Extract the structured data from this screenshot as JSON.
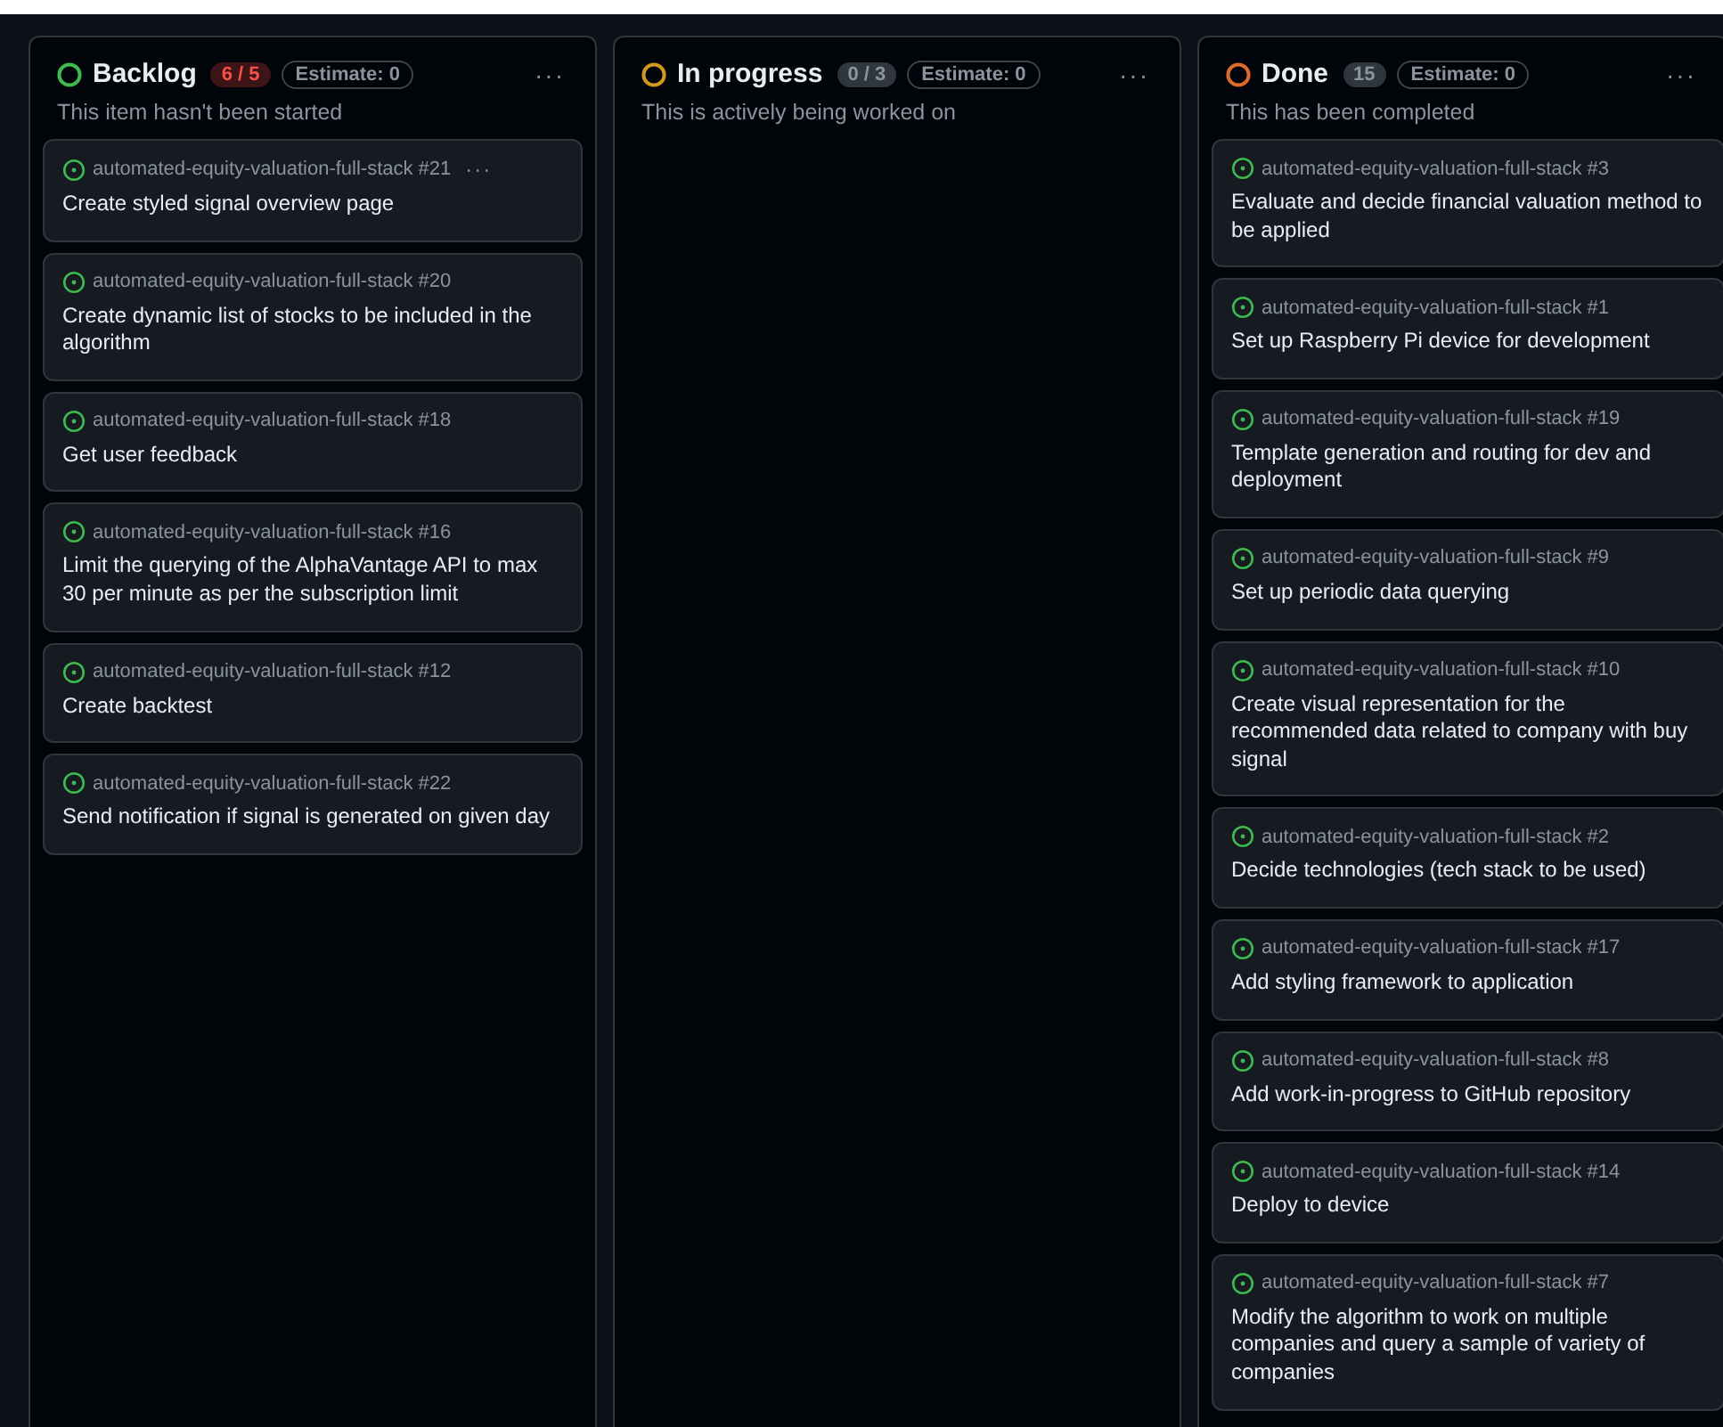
{
  "columns": [
    {
      "title": "Backlog",
      "color": "#3fb950",
      "count": "6 / 5",
      "over_limit": true,
      "estimate": "Estimate: 0",
      "menu": "···",
      "description": "This item hasn't been started",
      "cards": [
        {
          "repo": "automated-equity-valuation-full-stack #21",
          "title": "Create styled signal overview page",
          "menu": "···"
        },
        {
          "repo": "automated-equity-valuation-full-stack #20",
          "title": "Create dynamic list of stocks to be included in the algorithm"
        },
        {
          "repo": "automated-equity-valuation-full-stack #18",
          "title": "Get user feedback"
        },
        {
          "repo": "automated-equity-valuation-full-stack #16",
          "title": "Limit the querying of the AlphaVantage API to max 30 per minute as per the subscription limit"
        },
        {
          "repo": "automated-equity-valuation-full-stack #12",
          "title": "Create backtest"
        },
        {
          "repo": "automated-equity-valuation-full-stack #22",
          "title": "Send notification if signal is generated on given day"
        }
      ]
    },
    {
      "title": "In progress",
      "color": "#d29922",
      "count": "0 / 3",
      "over_limit": false,
      "estimate": "Estimate: 0",
      "menu": "···",
      "description": "This is actively being worked on"
    },
    {
      "title": "Done",
      "color": "#db6d28",
      "count": "15",
      "over_limit": false,
      "estimate": "Estimate: 0",
      "menu": "···",
      "description": "This has been completed",
      "cards": [
        {
          "repo": "automated-equity-valuation-full-stack #3",
          "title": "Evaluate and decide financial valuation method to be applied"
        },
        {
          "repo": "automated-equity-valuation-full-stack #1",
          "title": "Set up Raspberry Pi device for development"
        },
        {
          "repo": "automated-equity-valuation-full-stack #19",
          "title": "Template generation and routing for dev and deployment"
        },
        {
          "repo": "automated-equity-valuation-full-stack #9",
          "title": "Set up periodic data querying"
        },
        {
          "repo": "automated-equity-valuation-full-stack #10",
          "title": "Create visual representation for the recommended data related to company with buy signal"
        },
        {
          "repo": "automated-equity-valuation-full-stack #2",
          "title": "Decide technologies (tech stack to be used)"
        },
        {
          "repo": "automated-equity-valuation-full-stack #17",
          "title": "Add styling framework to application"
        },
        {
          "repo": "automated-equity-valuation-full-stack #8",
          "title": "Add work-in-progress to GitHub repository"
        },
        {
          "repo": "automated-equity-valuation-full-stack #14",
          "title": "Deploy to device"
        },
        {
          "repo": "automated-equity-valuation-full-stack #7",
          "title": "Modify the algorithm to work on multiple companies and query a sample of variety of companies"
        }
      ]
    }
  ]
}
